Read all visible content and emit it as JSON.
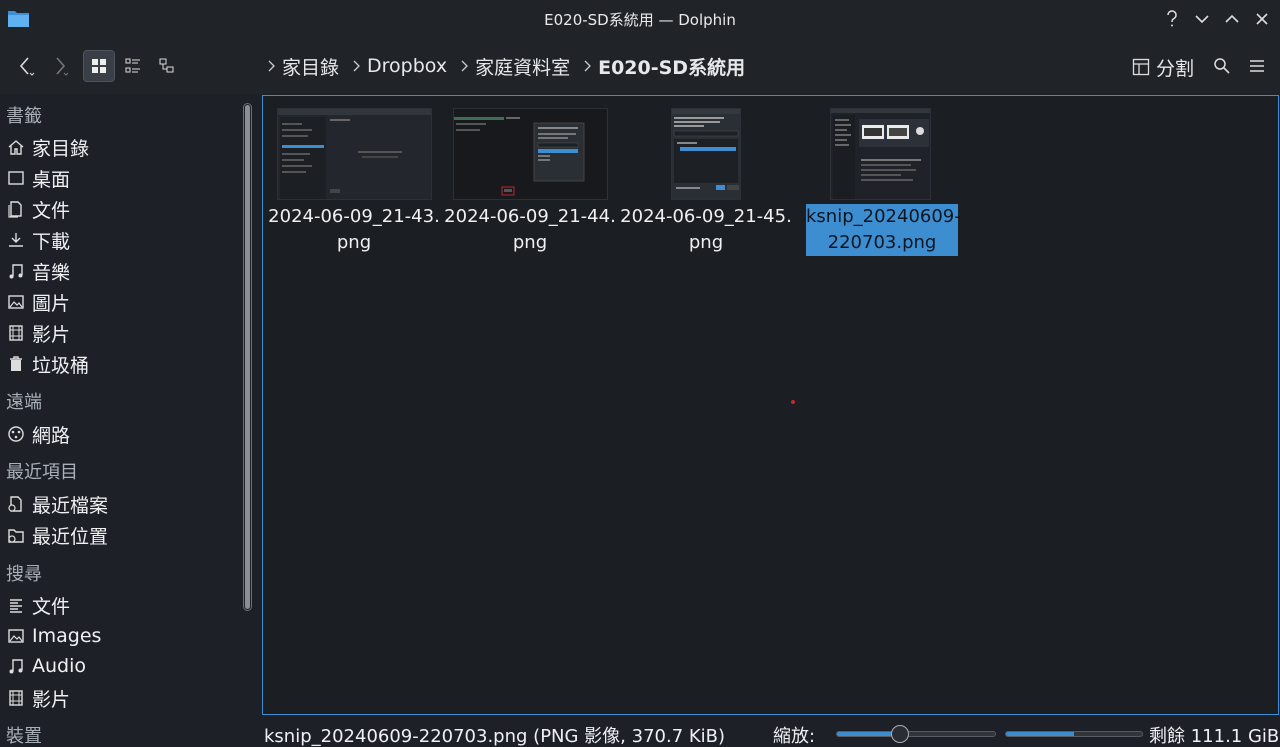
{
  "window": {
    "title": "E020-SD系統用 — Dolphin"
  },
  "breadcrumb": [
    "家目錄",
    "Dropbox",
    "家庭資料室",
    "E020-SD系統用"
  ],
  "toolbar": {
    "split_label": "分割"
  },
  "sidebar": {
    "sections": [
      {
        "header": "書籤",
        "items": [
          {
            "label": "家目錄",
            "icon": "home-icon"
          },
          {
            "label": "桌面",
            "icon": "desktop-icon"
          },
          {
            "label": "文件",
            "icon": "document-icon"
          },
          {
            "label": "下載",
            "icon": "download-icon"
          },
          {
            "label": "音樂",
            "icon": "music-icon"
          },
          {
            "label": "圖片",
            "icon": "picture-icon"
          },
          {
            "label": "影片",
            "icon": "video-icon"
          },
          {
            "label": "垃圾桶",
            "icon": "trash-icon"
          }
        ]
      },
      {
        "header": "遠端",
        "items": [
          {
            "label": "網路",
            "icon": "network-icon"
          }
        ]
      },
      {
        "header": "最近項目",
        "items": [
          {
            "label": "最近檔案",
            "icon": "recent-files-icon"
          },
          {
            "label": "最近位置",
            "icon": "recent-locations-icon"
          }
        ]
      },
      {
        "header": "搜尋",
        "items": [
          {
            "label": "文件",
            "icon": "text-document-icon"
          },
          {
            "label": "Images",
            "icon": "picture-icon"
          },
          {
            "label": "Audio",
            "icon": "music-icon"
          },
          {
            "label": "影片",
            "icon": "video-icon"
          }
        ]
      },
      {
        "header": "裝置",
        "items": []
      }
    ]
  },
  "files": [
    {
      "line1": "2024-06-09_21-43.",
      "line2": "png",
      "selected": false
    },
    {
      "line1": "2024-06-09_21-44.",
      "line2": "png",
      "selected": false
    },
    {
      "line1": "2024-06-09_21-45.",
      "line2": "png",
      "selected": false
    },
    {
      "line1": "ksnip_20240609-",
      "line2": "220703.png",
      "selected": true
    }
  ],
  "status": {
    "text": "ksnip_20240609-220703.png (PNG 影像, 370.7 KiB)",
    "zoom_label": "縮放:",
    "zoom_fraction": 0.4,
    "free_space": "剩餘 111.1 GiB",
    "used_fraction": 0.5
  },
  "colors": {
    "accent": "#3d8ed0",
    "background": "#1b1e23"
  }
}
